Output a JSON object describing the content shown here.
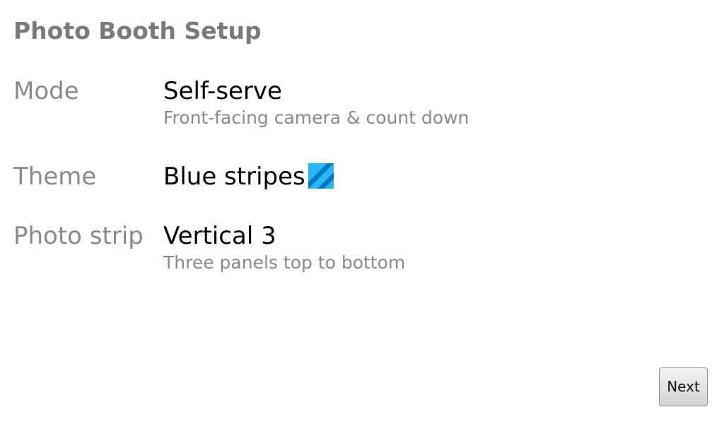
{
  "page": {
    "title": "Photo Booth Setup"
  },
  "settings": [
    {
      "label": "Mode",
      "value": "Self-serve",
      "description": "Front-facing camera & count down"
    },
    {
      "label": "Theme",
      "value": "Blue stripes",
      "icon": "blue-stripes-swatch-icon",
      "colors": [
        "#29b6f6",
        "#0277bd"
      ]
    },
    {
      "label": "Photo strip",
      "value": "Vertical 3",
      "description": "Three panels top to bottom"
    }
  ],
  "actions": {
    "next_label": "Next"
  }
}
